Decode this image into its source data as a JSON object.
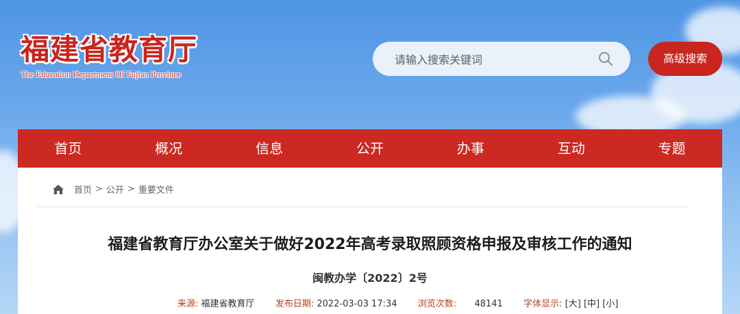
{
  "header": {
    "logo_cn": "福建省教育厅",
    "logo_en": "The Education Department Of Fujian Province",
    "search_placeholder": "请输入搜索关键词",
    "advanced_search_label": "高级搜索"
  },
  "nav": {
    "items": [
      "首页",
      "概况",
      "信息",
      "公开",
      "办事",
      "互动",
      "专题"
    ]
  },
  "breadcrumb": {
    "items": [
      "首页",
      "公开",
      "重要文件"
    ],
    "separator": ">"
  },
  "article": {
    "title": "福建省教育厅办公室关于做好2022年高考录取照顾资格申报及审核工作的通知",
    "doc_number": "闽教办学〔2022〕2号",
    "meta": {
      "source_label": "来源:",
      "source_value": "福建省教育厅",
      "date_label": "发布日期:",
      "date_value": "2022-03-03 17:34",
      "views_label": "浏览次数:",
      "views_value": "48141",
      "font_label": "字体显示:",
      "font_large": "[大]",
      "font_medium": "[中]",
      "font_small": "[小]"
    }
  },
  "colors": {
    "brand_red": "#cb2921",
    "sky_blue": "#5a9ce6"
  }
}
